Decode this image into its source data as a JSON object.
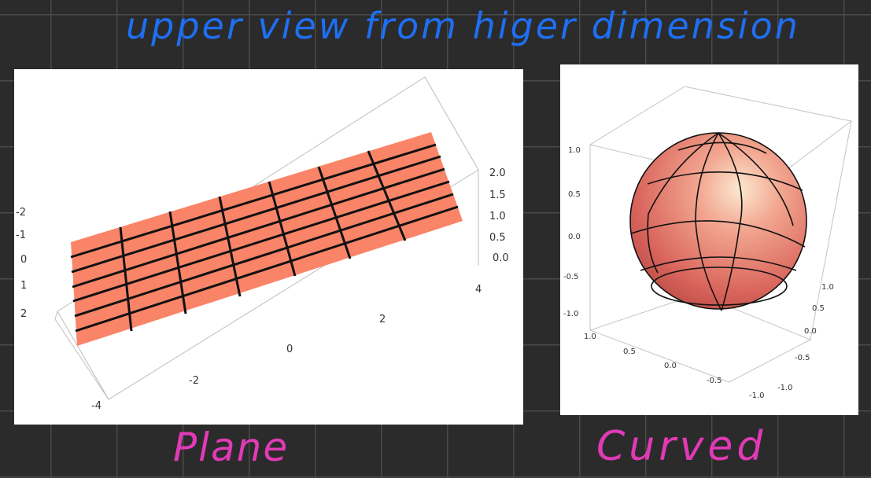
{
  "notes": {
    "heading": "upper view from higer dimension",
    "left_caption": "Plane",
    "right_caption": "Curved"
  },
  "plane_plot": {
    "surface_color": "#fa8468",
    "mesh_color": "#111111",
    "x_ticks": [
      "-4",
      "-2",
      "0",
      "2",
      "4"
    ],
    "y_ticks": [
      "-2",
      "-1",
      "0",
      "1",
      "2"
    ],
    "z_ticks": [
      "2.0",
      "1.5",
      "1.0",
      "0.5",
      "0.0"
    ]
  },
  "sphere_plot": {
    "surface_color": "#d9655c",
    "highlight_color": "#fde8d0",
    "mesh_color": "#111111",
    "z_ticks": [
      "1.0",
      "0.5",
      "0.0",
      "-0.5",
      "-1.0"
    ],
    "x_ticks": [
      "1.0",
      "0.5",
      "0.0",
      "-0.5",
      "-1.0"
    ],
    "y_ticks": [
      "1.0",
      "0.5",
      "0.0",
      "-0.5",
      "-1.0"
    ]
  }
}
